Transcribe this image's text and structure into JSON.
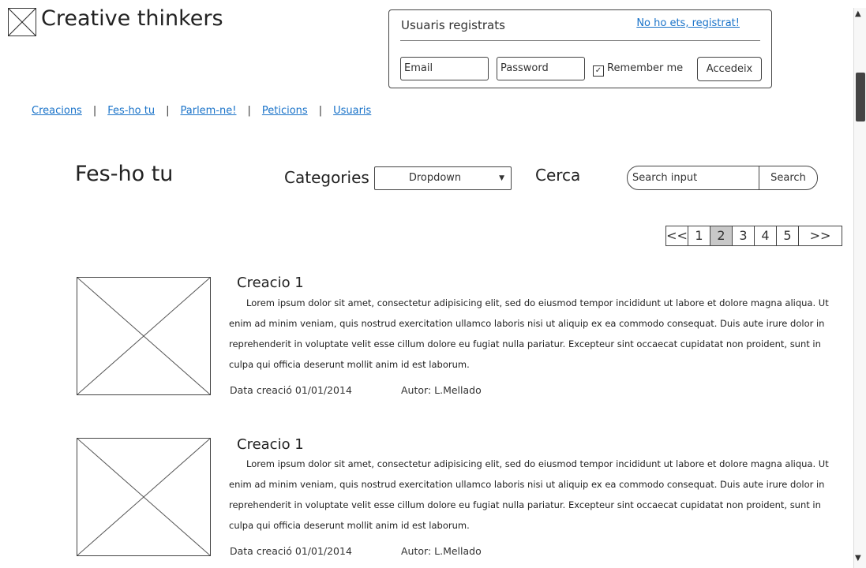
{
  "logo": {
    "text": "Creative thinkers",
    "icon": "image-placeholder-icon"
  },
  "login": {
    "title": "Usuaris registrats",
    "register_link": "No ho ets, registrat!",
    "email_placeholder": "Email",
    "password_placeholder": "Password",
    "remember_label": "Remember me",
    "remember_checked": true,
    "submit_label": "Accedeix"
  },
  "nav": {
    "items": [
      "Creacions",
      "Fes-ho tu",
      "Parlem-ne!",
      "Peticions",
      "Usuaris"
    ]
  },
  "section": {
    "title": "Fes-ho tu",
    "categories_label": "Categories",
    "dropdown_value": "Dropdown",
    "search_label": "Cerca",
    "search_placeholder": "Search input",
    "search_button": "Search"
  },
  "pagination": {
    "first": "<<",
    "pages": [
      "1",
      "2",
      "3",
      "4",
      "5"
    ],
    "active_page": "2",
    "last": ">>"
  },
  "items": [
    {
      "title": "Creacio 1",
      "description": "Lorem ipsum dolor sit amet, consectetur adipisicing elit, sed do eiusmod tempor incididunt ut labore et dolore magna aliqua. Ut enim ad minim veniam, quis nostrud exercitation ullamco laboris nisi ut aliquip ex ea commodo consequat. Duis aute irure dolor in reprehenderit in voluptate velit esse cillum dolore eu fugiat nulla pariatur. Excepteur sint occaecat cupidatat non proident, sunt in culpa qui officia deserunt mollit anim id est laborum.",
      "date": "Data creació 01/01/2014",
      "author": "Autor: L.Mellado"
    },
    {
      "title": "Creacio 1",
      "description": "Lorem ipsum dolor sit amet, consectetur adipisicing elit, sed do eiusmod tempor incididunt ut labore et dolore magna aliqua. Ut enim ad minim veniam, quis nostrud exercitation ullamco laboris nisi ut aliquip ex ea commodo consequat. Duis aute irure dolor in reprehenderit in voluptate velit esse cillum dolore eu fugiat nulla pariatur. Excepteur sint occaecat cupidatat non proident, sunt in culpa qui officia deserunt mollit anim id est laborum.",
      "date": "Data creació 01/01/2014",
      "author": "Autor: L.Mellado"
    }
  ],
  "scrollbar": {
    "up_icon": "arrow-up-icon",
    "down_icon": "arrow-down-icon"
  }
}
